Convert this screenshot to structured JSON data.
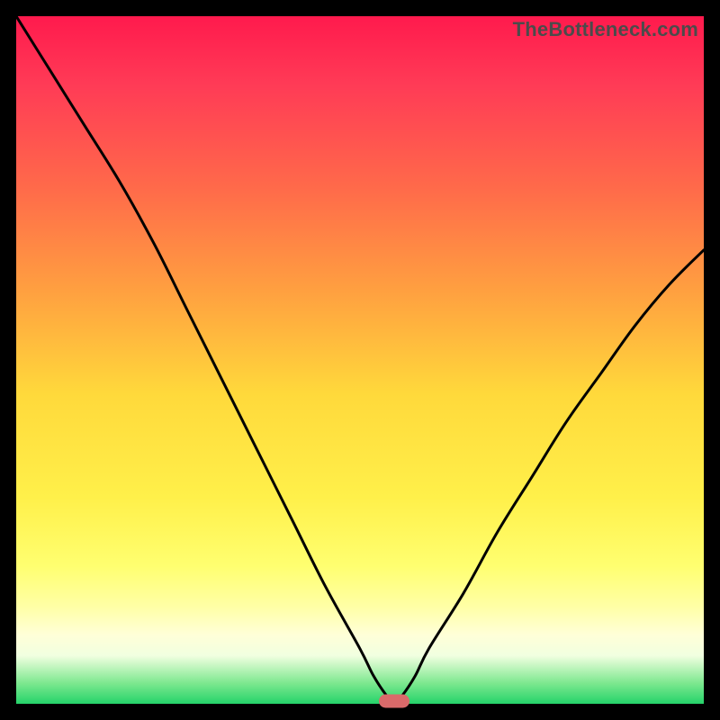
{
  "watermark": "TheBottleneck.com",
  "chart_data": {
    "type": "line",
    "title": "",
    "xlabel": "",
    "ylabel": "",
    "xlim": [
      0,
      100
    ],
    "ylim": [
      0,
      100
    ],
    "grid": false,
    "legend": false,
    "series": [
      {
        "name": "bottleneck-curve",
        "x": [
          0,
          5,
          10,
          15,
          20,
          25,
          30,
          35,
          40,
          45,
          50,
          52,
          54,
          55,
          56,
          58,
          60,
          65,
          70,
          75,
          80,
          85,
          90,
          95,
          100
        ],
        "y": [
          100,
          92,
          84,
          76,
          67,
          57,
          47,
          37,
          27,
          17,
          8,
          4,
          1,
          0,
          1,
          4,
          8,
          16,
          25,
          33,
          41,
          48,
          55,
          61,
          66
        ]
      }
    ],
    "annotations": [
      {
        "name": "optimal-marker",
        "x": 55,
        "y": 0,
        "color": "#d96a6a"
      }
    ],
    "background_gradient": {
      "top": "#ff1a4d",
      "bottom": "#25d36a",
      "stops": [
        "red",
        "orange",
        "yellow",
        "pale-yellow",
        "green"
      ]
    }
  }
}
